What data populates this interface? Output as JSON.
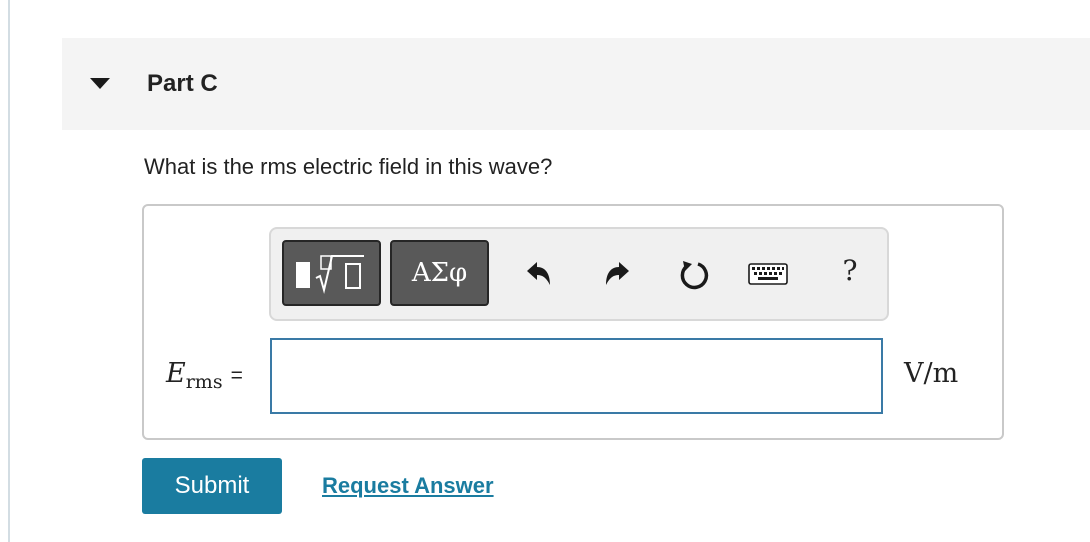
{
  "part": {
    "title": "Part C"
  },
  "question": {
    "text": "What is the rms electric field in this wave?"
  },
  "toolbar": {
    "templates_icon": "templates-icon",
    "symbols_label": "ΑΣφ",
    "undo_icon": "undo-icon",
    "redo_icon": "redo-icon",
    "reset_icon": "reset-icon",
    "keyboard_icon": "keyboard-icon",
    "help_label": "?"
  },
  "answer": {
    "variable": "E",
    "subscript": "rms",
    "equals": "=",
    "value": "",
    "units": "V/m"
  },
  "actions": {
    "submit_label": "Submit",
    "request_label": "Request Answer"
  },
  "colors": {
    "accent": "#1a7ca0",
    "input_border": "#3a7aa6",
    "header_bg": "#f4f4f4"
  }
}
